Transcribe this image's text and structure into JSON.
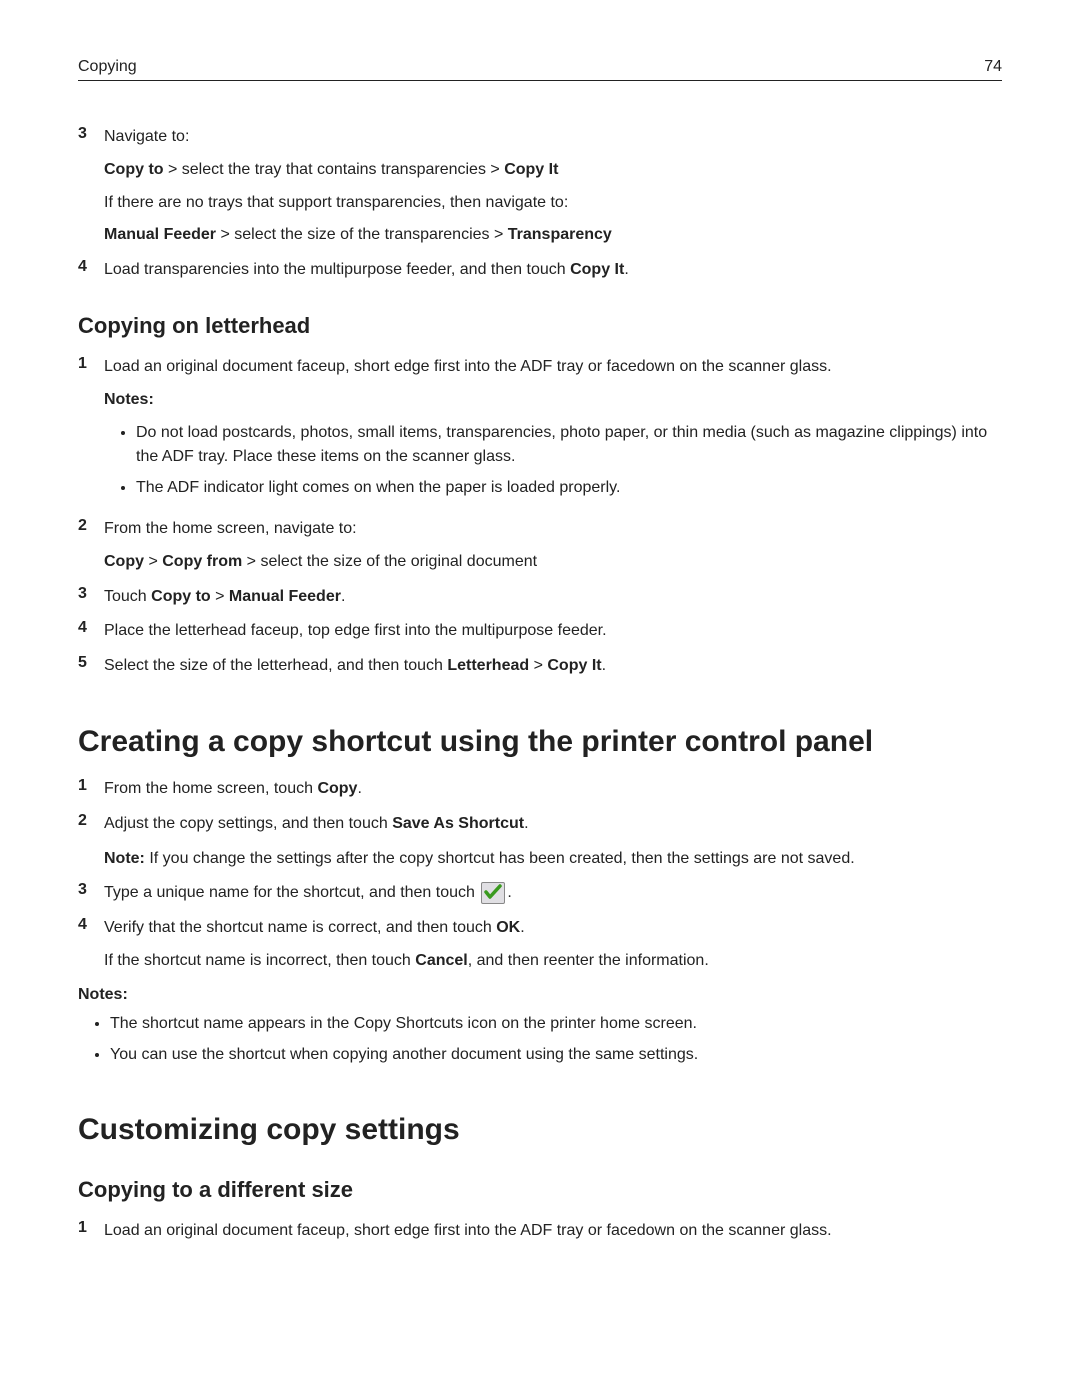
{
  "header": {
    "left": "Copying",
    "right": "74"
  },
  "topSteps": {
    "s3": {
      "num": "3",
      "intro": "Navigate to:",
      "line1": {
        "lead": "Copy to",
        "rest": " > select the tray that contains transparencies > ",
        "tail": "Copy It"
      },
      "line2": "If there are no trays that support transparencies, then navigate to:",
      "line3": {
        "lead": "Manual Feeder",
        "rest": " > select the size of the transparencies > ",
        "tail": "Transparency"
      }
    },
    "s4": {
      "num": "4",
      "textA": "Load transparencies into the multipurpose feeder, and then touch ",
      "bold": "Copy It",
      "textB": "."
    }
  },
  "letterhead": {
    "heading": "Copying on letterhead",
    "s1": {
      "num": "1",
      "text": "Load an original document faceup, short edge first into the ADF tray or facedown on the scanner glass.",
      "notesLabel": "Notes:",
      "bullets": [
        "Do not load postcards, photos, small items, transparencies, photo paper, or thin media (such as magazine clippings) into the ADF tray. Place these items on the scanner glass.",
        "The ADF indicator light comes on when the paper is loaded properly."
      ]
    },
    "s2": {
      "num": "2",
      "intro": "From the home screen, navigate to:",
      "line": {
        "a": "Copy",
        "b": " > ",
        "c": "Copy from",
        "d": " > select the size of the original document"
      }
    },
    "s3": {
      "num": "3",
      "a": "Touch ",
      "b": "Copy to",
      "c": " > ",
      "d": "Manual Feeder",
      "e": "."
    },
    "s4": {
      "num": "4",
      "text": "Place the letterhead faceup, top edge first into the multipurpose feeder."
    },
    "s5": {
      "num": "5",
      "a": "Select the size of the letterhead, and then touch ",
      "b": "Letterhead",
      "c": " > ",
      "d": "Copy It",
      "e": "."
    }
  },
  "shortcut": {
    "heading": "Creating a copy shortcut using the printer control panel",
    "s1": {
      "num": "1",
      "a": "From the home screen, touch ",
      "b": "Copy",
      "c": "."
    },
    "s2": {
      "num": "2",
      "a": "Adjust the copy settings, and then touch ",
      "b": "Save As Shortcut",
      "c": ".",
      "noteLead": "Note:",
      "noteRest": " If you change the settings after the copy shortcut has been created, then the settings are not saved."
    },
    "s3": {
      "num": "3",
      "a": "Type a unique name for the shortcut, and then touch ",
      "c": "."
    },
    "s4": {
      "num": "4",
      "a": "Verify that the shortcut name is correct, and then touch ",
      "b": "OK",
      "c": ".",
      "line2a": "If the shortcut name is incorrect, then touch ",
      "line2b": "Cancel",
      "line2c": ", and then reenter the information."
    },
    "notesLabel": "Notes:",
    "bullets": [
      "The shortcut name appears in the Copy Shortcuts icon on the printer home screen.",
      "You can use the shortcut when copying another document using the same settings."
    ]
  },
  "customize": {
    "heading": "Customizing copy settings",
    "sub": {
      "heading": "Copying to a different size",
      "s1": {
        "num": "1",
        "text": "Load an original document faceup, short edge first into the ADF tray or facedown on the scanner glass."
      }
    }
  }
}
